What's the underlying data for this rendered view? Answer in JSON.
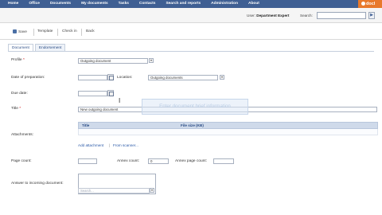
{
  "nav": {
    "items": [
      "Home",
      "Office",
      "Documents",
      "My documents",
      "Tasks",
      "Contacts",
      "Search and reports",
      "Administration",
      "About"
    ],
    "brand": "docl"
  },
  "userbar": {
    "user_prefix": "User:",
    "user_name": "Department Expert",
    "search_label": "Search:",
    "search_value": "",
    "search_button": "▶"
  },
  "toolbar": {
    "save": "Save",
    "template": "Template",
    "check_in": "Check in",
    "back": "Back"
  },
  "tabs": [
    "Document",
    "Endorsement"
  ],
  "form": {
    "profile_label": "Profile",
    "profile_value": "Outgoing document",
    "date_label": "Date of preparation:",
    "date_value": "",
    "location_label": "Location:",
    "location_value": "Outgoing documents",
    "due_label": "Due date:",
    "due_value": "",
    "title_label": "Title",
    "title_value": "New outgoing document",
    "overlay_text": "Enter document brief information",
    "attachments_label": "Attachments:",
    "att_col_title": "Title",
    "att_col_size": "File size (KB)",
    "add_attachment": "Add attachment",
    "link_sep": "|",
    "from_scanner": "From scanner...",
    "page_count_label": "Page count:",
    "page_count_value": "",
    "annex_count_label": "Annex count:",
    "annex_count_value": "0",
    "annex_page_label": "Annex page count:",
    "annex_page_value": "",
    "answer_label": "Answer to incoming document:",
    "answer_search_placeholder": "Search..."
  },
  "colors": {
    "nav_bg": "#3f5f93",
    "brand_bg": "#e8792b",
    "link": "#2b5aa8",
    "required": "#cc0000"
  }
}
